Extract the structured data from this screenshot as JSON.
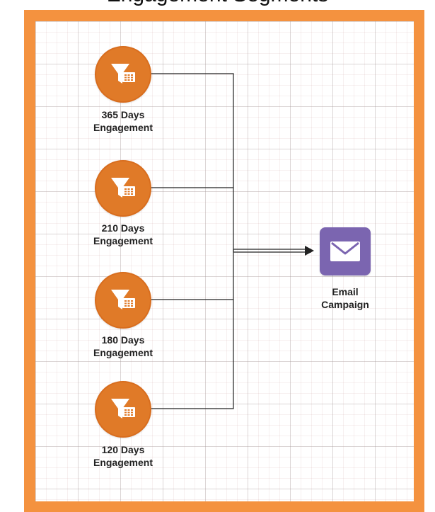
{
  "colors": {
    "frame": "#f4923f",
    "node_fill": "#e07a28",
    "email_fill": "#7b65b0",
    "connector": "#222222"
  },
  "nodes": [
    {
      "icon": "funnel-grid-icon",
      "line1": "365 Days",
      "line2": "Engagement"
    },
    {
      "icon": "funnel-grid-icon",
      "line1": "210 Days",
      "line2": "Engagement"
    },
    {
      "icon": "funnel-grid-icon",
      "line1": "180 Days",
      "line2": "Engagement"
    },
    {
      "icon": "funnel-grid-icon",
      "line1": "120 Days",
      "line2": "Engagement"
    }
  ],
  "target": {
    "icon": "envelope-icon",
    "line1": "Email",
    "line2": "Campaign"
  }
}
